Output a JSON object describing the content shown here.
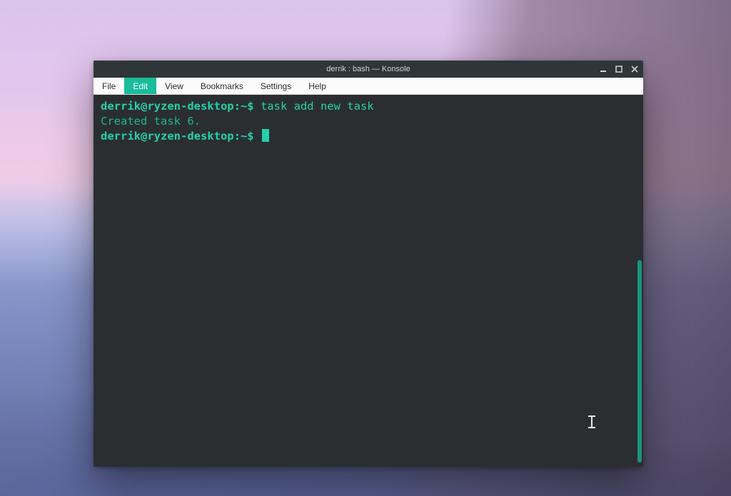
{
  "window": {
    "title": "derrik : bash — Konsole"
  },
  "menu": {
    "file": "File",
    "edit": "Edit",
    "view": "View",
    "bookmarks": "Bookmarks",
    "settings": "Settings",
    "help": "Help",
    "active": "edit"
  },
  "terminal": {
    "prompt1": "derrik@ryzen-desktop:~$ ",
    "command1": "task add new task",
    "output1": "Created task 6.",
    "prompt2": "derrik@ryzen-desktop:~$ "
  },
  "colors": {
    "accent": "#1abc9c",
    "term_bg": "#2a2e30",
    "term_prompt": "#25d0ab",
    "term_output": "#1bb793"
  }
}
